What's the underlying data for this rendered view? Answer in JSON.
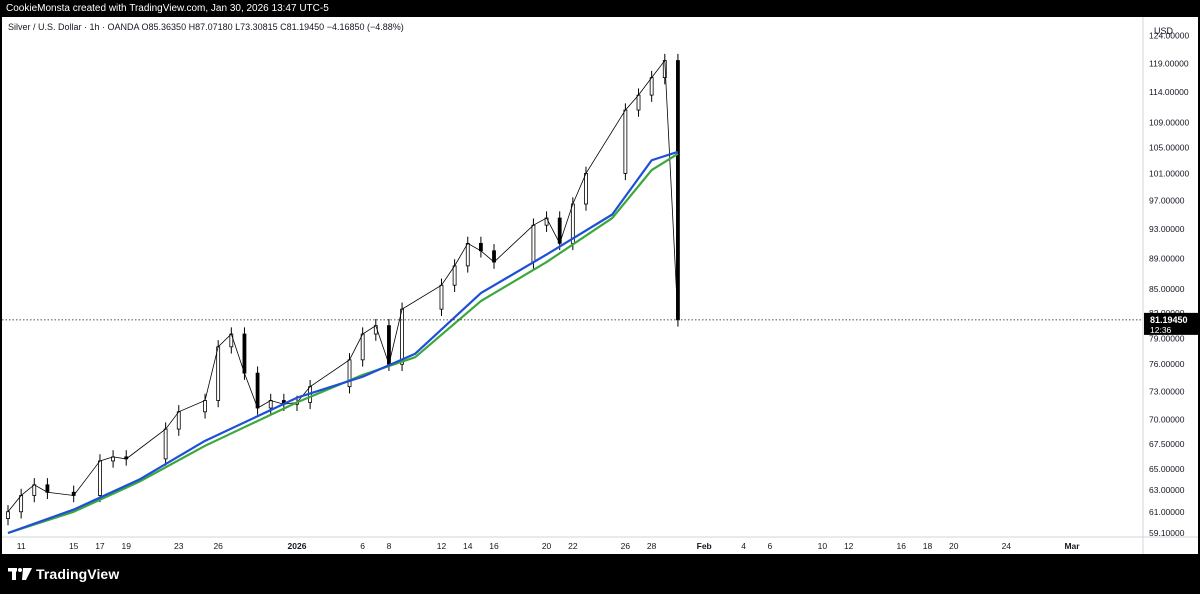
{
  "header": {
    "caption": "CookieMonsta created with TradingView.com, Jan 30, 2026 13:47 UTC-5"
  },
  "legend": {
    "symbol_line": "Silver / U.S. Dollar · 1h · OANDA  O85.36350  H87.07180  L73.30815  C81.19450  −4.16850 (−4.88%)"
  },
  "price_axis": {
    "currency": "USD",
    "labels": [
      "124.00000",
      "119.00000",
      "114.00000",
      "109.00000",
      "105.00000",
      "101.00000",
      "97.00000",
      "93.00000",
      "89.00000",
      "85.00000",
      "82.00000",
      "79.00000",
      "76.00000",
      "73.00000",
      "70.00000",
      "67.50000",
      "65.00000",
      "63.00000",
      "61.00000",
      "59.10000"
    ]
  },
  "last_price": {
    "price": "81.19450",
    "countdown": "12:36",
    "color": "#000000"
  },
  "time_axis": {
    "labels": [
      "11",
      "15",
      "17",
      "19",
      "23",
      "26",
      "2026",
      "6",
      "8",
      "12",
      "14",
      "16",
      "20",
      "22",
      "26",
      "28",
      "Feb",
      "4",
      "6",
      "10",
      "12",
      "16",
      "18",
      "20",
      "24",
      "Mar"
    ]
  },
  "footer": {
    "brand": "TradingView",
    "logo_icon": "tradingview-logo-icon"
  },
  "colors": {
    "candles": "#000000",
    "ma_fast": "#1f4fd8",
    "ma_slow": "#3aa83a",
    "background": "#ffffff"
  },
  "chart_data": {
    "type": "line",
    "title": "Silver / U.S. Dollar · 1h · OANDA",
    "xlabel": "",
    "ylabel": "USD",
    "scale": "log",
    "ylim": [
      59.1,
      126
    ],
    "x_range": [
      "2025-12-10",
      "2026-03-01"
    ],
    "grid": false,
    "series": [
      {
        "name": "",
        "style": "candles",
        "x": [
          "2025-12-10",
          "2025-12-11",
          "2025-12-12",
          "2025-12-13",
          "2025-12-15",
          "2025-12-17",
          "2025-12-18",
          "2025-12-19",
          "2025-12-22",
          "2025-12-23",
          "2025-12-25",
          "2025-12-26",
          "2025-12-27",
          "2025-12-28",
          "2025-12-29",
          "2025-12-30",
          "2025-12-31",
          "2026-01-01",
          "2026-01-02",
          "2026-01-05",
          "2026-01-06",
          "2026-01-07",
          "2026-01-08",
          "2026-01-09",
          "2026-01-12",
          "2026-01-13",
          "2026-01-14",
          "2026-01-15",
          "2026-01-16",
          "2026-01-19",
          "2026-01-20",
          "2026-01-21",
          "2026-01-22",
          "2026-01-23",
          "2026-01-26",
          "2026-01-27",
          "2026-01-28",
          "2026-01-29",
          "2026-01-30"
        ],
        "values": [
          61.0,
          62.5,
          63.5,
          62.8,
          62.5,
          65.8,
          66.2,
          66.0,
          69.0,
          70.8,
          72.0,
          78.0,
          79.5,
          75.0,
          71.2,
          72.0,
          71.6,
          71.8,
          73.5,
          76.5,
          79.5,
          80.5,
          76.0,
          82.5,
          85.5,
          88.0,
          91.0,
          90.0,
          88.5,
          93.5,
          94.5,
          91.0,
          96.5,
          101.0,
          111.0,
          113.5,
          116.5,
          119.5,
          81.2
        ]
      },
      {
        "name": "",
        "style": "ma_fast",
        "x": [
          "2025-12-10",
          "2025-12-15",
          "2025-12-20",
          "2025-12-25",
          "2026-01-01",
          "2026-01-06",
          "2026-01-10",
          "2026-01-15",
          "2026-01-20",
          "2026-01-25",
          "2026-01-28",
          "2026-01-30"
        ],
        "values": [
          59.1,
          61.2,
          64.0,
          67.8,
          72.3,
          74.6,
          77.2,
          84.5,
          89.5,
          95.0,
          103.0,
          104.3
        ]
      },
      {
        "name": "",
        "style": "ma_slow",
        "x": [
          "2025-12-10",
          "2025-12-15",
          "2025-12-20",
          "2025-12-25",
          "2026-01-01",
          "2026-01-06",
          "2026-01-10",
          "2026-01-15",
          "2026-01-20",
          "2026-01-25",
          "2026-01-28",
          "2026-01-30"
        ],
        "values": [
          59.1,
          61.0,
          63.8,
          67.3,
          71.8,
          74.8,
          76.8,
          83.5,
          88.5,
          94.5,
          101.5,
          104.0
        ]
      }
    ]
  }
}
